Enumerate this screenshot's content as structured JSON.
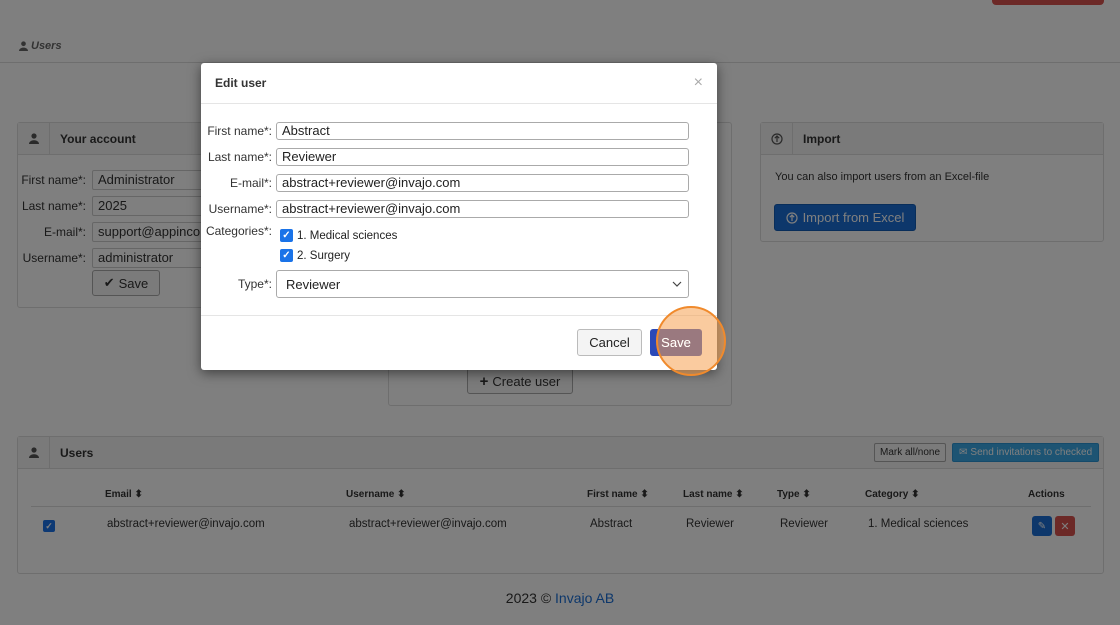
{
  "breadcrumb": {
    "label": "Users"
  },
  "account_panel": {
    "title": "Your account",
    "fields": [
      {
        "label": "First name*:",
        "value": "Administrator"
      },
      {
        "label": "Last name*:",
        "value": "2025"
      },
      {
        "label": "E-mail*:",
        "value": "support@appinco"
      },
      {
        "label": "Username*:",
        "value": "administrator"
      }
    ],
    "save_label": "Save"
  },
  "create_user_label": "Create user",
  "import_panel": {
    "title": "Import",
    "text": "You can also import users from an Excel-file",
    "button_label": "Import from Excel"
  },
  "users_panel": {
    "title": "Users",
    "mark_label": "Mark all/none",
    "send_label": "Send invitations to checked",
    "columns": [
      "Email",
      "Username",
      "First name",
      "Last name",
      "Type",
      "Category",
      "Actions"
    ],
    "rows": [
      {
        "email": "abstract+reviewer@invajo.com",
        "username": "abstract+reviewer@invajo.com",
        "first_name": "Abstract",
        "last_name": "Reviewer",
        "type": "Reviewer",
        "category": "1. Medical sciences"
      }
    ]
  },
  "footer": {
    "text": "2023 © ",
    "link": "Invajo AB"
  },
  "modal": {
    "title": "Edit user",
    "close": "×",
    "fields": [
      {
        "label": "First name*:",
        "value": "Abstract"
      },
      {
        "label": "Last name*:",
        "value": "Reviewer"
      },
      {
        "label": "E-mail*:",
        "value": "abstract+reviewer@invajo.com"
      },
      {
        "label": "Username*:",
        "value": "abstract+reviewer@invajo.com"
      }
    ],
    "categories_label": "Categories*:",
    "categories": [
      {
        "label": "1. Medical sciences",
        "checked": true
      },
      {
        "label": "2. Surgery",
        "checked": true
      }
    ],
    "type_label": "Type*:",
    "type_value": "Reviewer",
    "cancel_label": "Cancel",
    "save_label": "Save"
  },
  "colors": {
    "primary": "#1a6fd6",
    "save": "#2b49b8",
    "danger": "#d9534f",
    "highlight": "#f08a2c"
  }
}
